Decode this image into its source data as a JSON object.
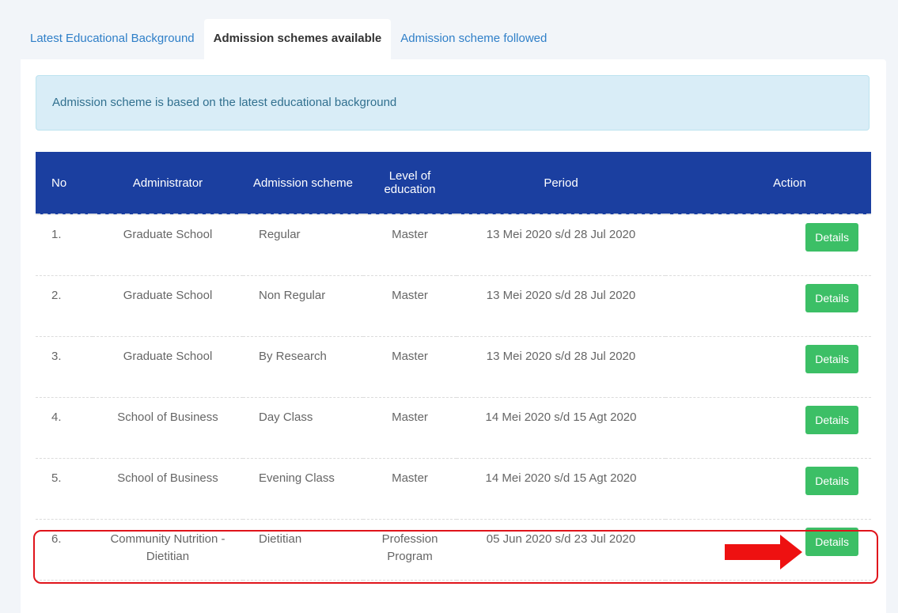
{
  "tabs": [
    {
      "label": "Latest Educational Background",
      "active": false
    },
    {
      "label": "Admission schemes available",
      "active": true
    },
    {
      "label": "Admission scheme followed",
      "active": false
    }
  ],
  "info_text": "Admission scheme is based on the latest educational background",
  "table": {
    "headers": {
      "no": "No",
      "administrator": "Administrator",
      "scheme": "Admission scheme",
      "level": "Level of education",
      "period": "Period",
      "action": "Action"
    },
    "rows": [
      {
        "no": "1.",
        "administrator": "Graduate School",
        "scheme": "Regular",
        "level": "Master",
        "period": "13 Mei 2020 s/d 28 Jul 2020",
        "action": "Details"
      },
      {
        "no": "2.",
        "administrator": "Graduate School",
        "scheme": "Non Regular",
        "level": "Master",
        "period": "13 Mei 2020 s/d 28 Jul 2020",
        "action": "Details"
      },
      {
        "no": "3.",
        "administrator": "Graduate School",
        "scheme": "By Research",
        "level": "Master",
        "period": "13 Mei 2020 s/d 28 Jul 2020",
        "action": "Details"
      },
      {
        "no": "4.",
        "administrator": "School of Business",
        "scheme": "Day Class",
        "level": "Master",
        "period": "14 Mei 2020 s/d 15 Agt 2020",
        "action": "Details"
      },
      {
        "no": "5.",
        "administrator": "School of Business",
        "scheme": "Evening Class",
        "level": "Master",
        "period": "14 Mei 2020 s/d 15 Agt 2020",
        "action": "Details"
      },
      {
        "no": "6.",
        "administrator": "Community Nutrition - Dietitian",
        "scheme": "Dietitian",
        "level": "Profession Program",
        "period": "05 Jun 2020 s/d 23 Jul 2020",
        "action": "Details"
      }
    ]
  },
  "colors": {
    "header_bg": "#1b3fa0",
    "button": "#3cbf66",
    "info_bg": "#d9edf7",
    "highlight": "#e0141b"
  },
  "annotation": {
    "highlight_row": 6,
    "arrow_icon": "right-arrow-icon"
  }
}
